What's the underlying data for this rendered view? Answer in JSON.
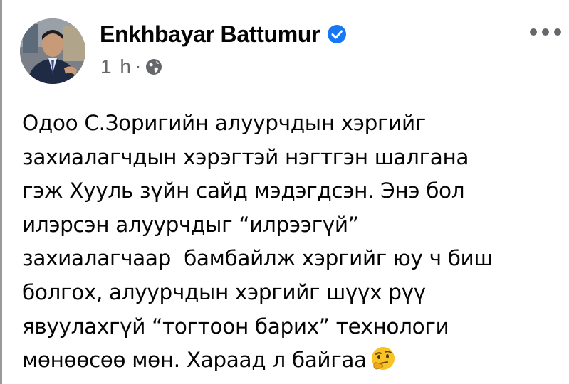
{
  "post": {
    "author": "Enkhbayar Battumur",
    "timestamp": "1 h",
    "separator": "·",
    "audience_icon": "globe-icon",
    "verified_icon": "verified-badge-icon",
    "more_icon": "more-options-icon",
    "lines": [
      "Одоо С.Зоригийн алуурчдын хэргийг",
      "захиалагчдын хэрэгтэй нэгтгэн шалгана",
      "гэж Хууль зүйн сайд мэдэгдсэн. Энэ бол",
      "илэрсэн алуурчдыг “илрээгүй”",
      "захиалагчаар  бамбайлж хэргийг юу ч биш",
      "болгох, алуурчдын хэргийг шүүх рүү",
      "явуулахгүй “тогтоон барих” технологи",
      "мөнөөсөө мөн. Хараад л байгаа"
    ],
    "end_emoji": "thinking-face-icon"
  },
  "colors": {
    "text": "#050505",
    "secondary": "#65676b",
    "verified": "#1877f2"
  }
}
